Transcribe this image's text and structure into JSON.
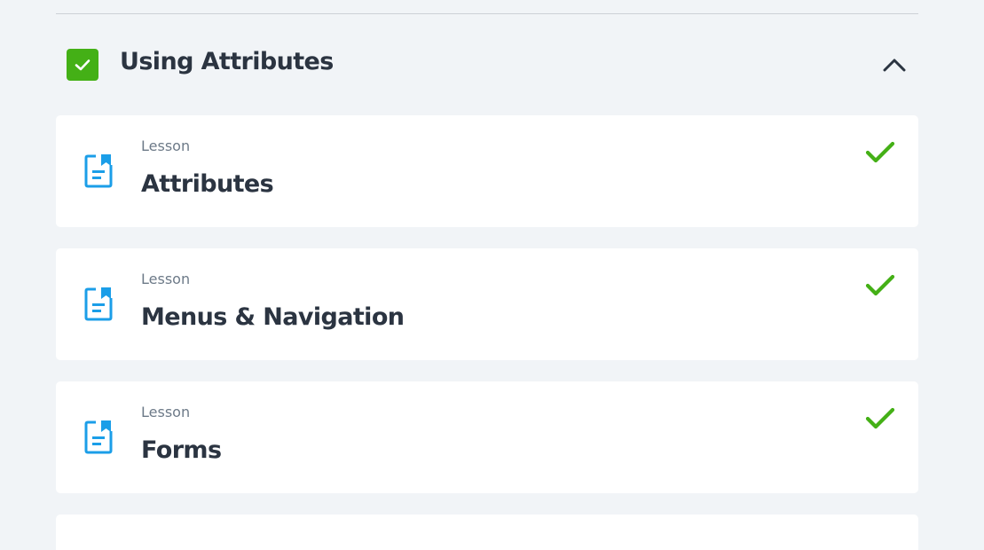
{
  "section": {
    "title": "Using Attributes",
    "completed": true,
    "expanded": true
  },
  "lessons": [
    {
      "type": "Lesson",
      "title": "Attributes",
      "completed": true
    },
    {
      "type": "Lesson",
      "title": "Menus & Navigation",
      "completed": true
    },
    {
      "type": "Lesson",
      "title": "Forms",
      "completed": true
    }
  ],
  "colors": {
    "success": "#44b016",
    "icon_blue": "#1b9ee8",
    "text_dark": "#2b3441",
    "text_muted": "#6d7a88",
    "page_bg": "#f1f4f7"
  },
  "icons": {
    "section_status": "checkbox-checked-icon",
    "collapse": "chevron-up-icon",
    "lesson": "document-bookmark-icon",
    "lesson_status": "checkmark-icon"
  }
}
